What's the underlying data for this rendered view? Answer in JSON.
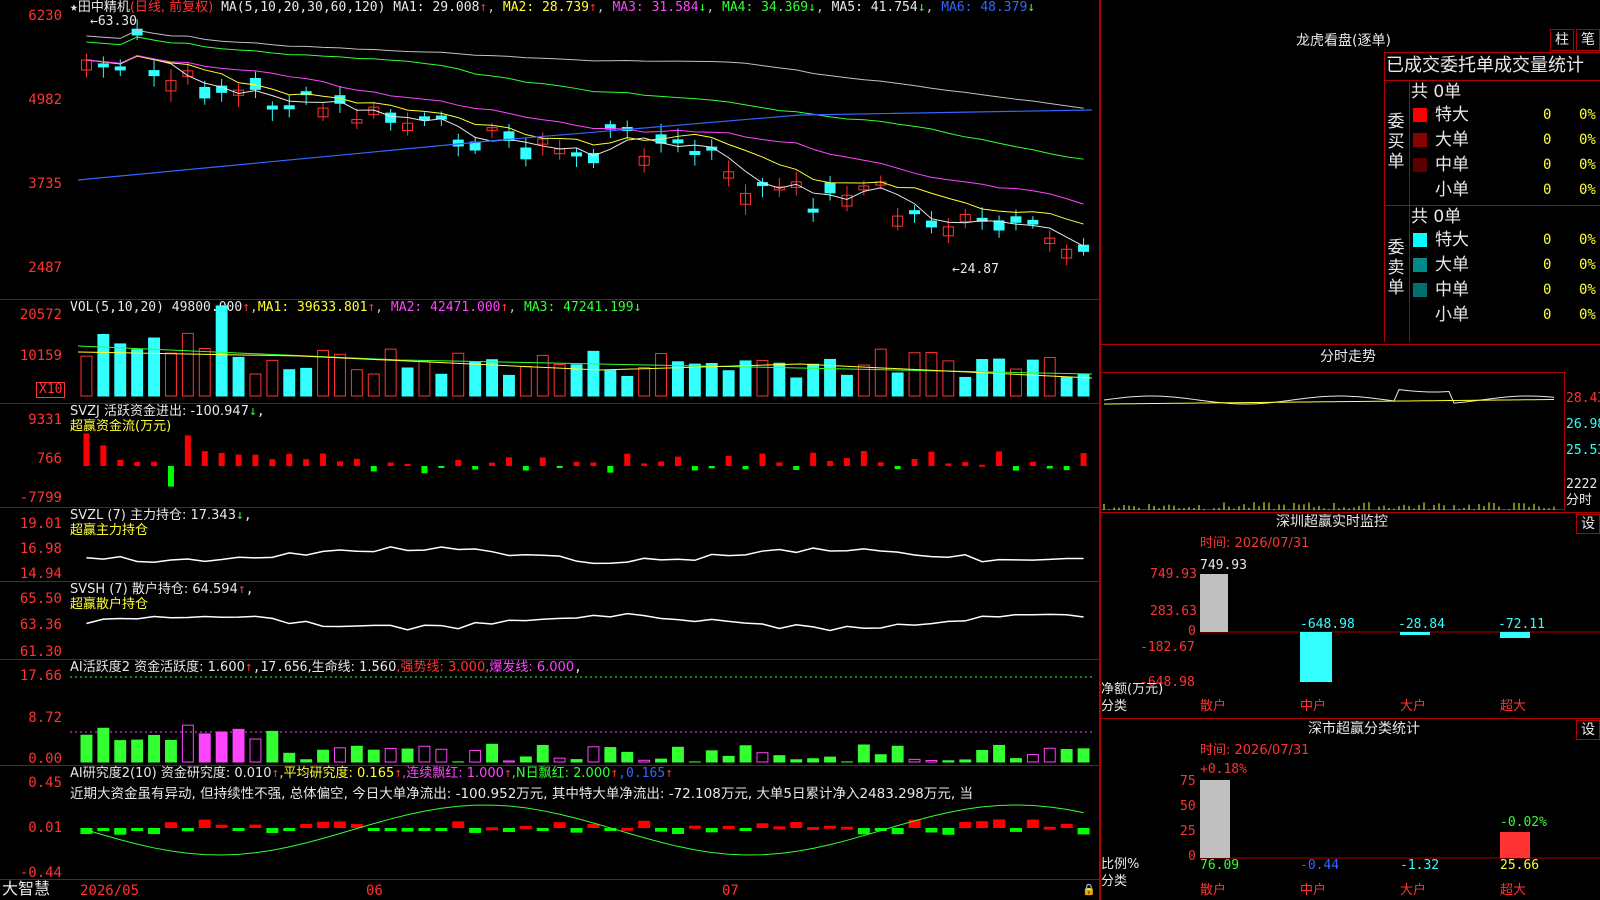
{
  "app": {
    "brand": "大智慧",
    "title_mark": "★",
    "stock_name": "田中精机",
    "period": "(日线, 前复权)"
  },
  "colors": {
    "up": "#ff3333",
    "down": "#33ffff",
    "ma1": "#e8e8e8",
    "ma2": "#ffff33",
    "ma3": "#ff44ff",
    "ma4": "#33ff33",
    "ma5": "#c0c0c0",
    "ma6": "#3366ff",
    "grid": "#b00000"
  },
  "price_pane": {
    "ma_header": "MA(5,10,20,30,60,120)",
    "ma1": "MA1: 29.008",
    "ma2": "MA2: 28.739",
    "ma3": "MA3: 31.584",
    "ma4": "MA4: 34.369",
    "ma5": "MA5: 41.754",
    "ma6": "MA6: 48.379",
    "ma1_arrow": "↑",
    "ma2_arrow": "↑",
    "ma3_arrow": "↓",
    "ma4_arrow": "↓",
    "ma5_arrow": "↓",
    "ma6_arrow": "↓",
    "y_ticks": [
      "6230",
      "4982",
      "3735",
      "2487"
    ],
    "high_mark": "←63.30",
    "low_mark": "←24.87"
  },
  "vol_pane": {
    "header": "VOL(5,10,20)",
    "value": "49800.000",
    "value_arrow": "↑",
    "ma1": "MA1: 39633.801",
    "ma1_arrow": "↑",
    "ma2": "MA2: 42471.000",
    "ma2_arrow": "↑",
    "ma3": "MA3: 47241.199",
    "ma3_arrow": "↓",
    "y_ticks": [
      "20572",
      "10159"
    ],
    "unit": "X10"
  },
  "svzj_pane": {
    "header": "SVZJ  活跃资金进出: -100.947",
    "arrow": "↓",
    "tail": ",",
    "sub": "超赢资金流(万元)",
    "y_ticks": [
      "9331",
      "766",
      "-7799"
    ]
  },
  "svzl_pane": {
    "header": "SVZL (7) 主力持仓: 17.343",
    "arrow": "↓",
    "tail": ",",
    "sub": "超赢主力持仓",
    "y_ticks": [
      "19.01",
      "16.98",
      "14.94"
    ]
  },
  "svsh_pane": {
    "header": "SVSH (7) 散户持仓: 64.594",
    "arrow": "↑",
    "tail": ",",
    "sub": "超赢散户持仓",
    "y_ticks": [
      "65.50",
      "63.36",
      "61.30"
    ]
  },
  "ai_act_pane": {
    "h1": "AI活跃度2 资金活跃度: 1.600",
    "h1_arrow": "↑",
    "h2": ",17.656",
    "h3": ",生命线: 1.560",
    "h4": ",强势线: 3.000",
    "h5": ",爆发线: 6.000",
    "h6": ",",
    "y_ticks": [
      "17.66",
      "8.72",
      "0.00"
    ]
  },
  "ai_res_pane": {
    "h1": "AI研究度2(10) 资金研究度: 0.010",
    "h1_arrow": "↑",
    "h2": ",平均研究度: 0.165",
    "h2_arrow": "↑",
    "h3": ",连续飘红: 1.000",
    "h3_arrow": "↑",
    "h4": ",N日飘红: 2.000",
    "h4_arrow": "↑",
    "h5": ",0.165",
    "h5_arrow": "↑",
    "note": "近期大资金虽有异动, 但持续性不强, 总体偏空, 今日大单净流出: -100.952万元, 其中特大单净流出: -72.108万元, 大单5日累计净入2483.298万元, 当",
    "y_ticks": [
      "0.45",
      "0.01",
      "-0.44"
    ]
  },
  "x_axis": {
    "labels": [
      "2026/05",
      "06",
      "07"
    ]
  },
  "dragon": {
    "title": "龙虎看盘(逐单)",
    "btn1": "柱",
    "btn2": "笔",
    "tabs": "已成交委托单成交量统计",
    "buy_label": "委买单",
    "buy_total": "共 0单",
    "sell_label": "委卖单",
    "sell_total": "共 0单",
    "rows_buy": [
      {
        "name": "特大",
        "v": "0",
        "p": "0%",
        "color": "#ff0000"
      },
      {
        "name": "大单",
        "v": "0",
        "p": "0%",
        "color": "#8b0000"
      },
      {
        "name": "中单",
        "v": "0",
        "p": "0%",
        "color": "#5a0000"
      },
      {
        "name": "小单",
        "v": "0",
        "p": "0%",
        "color": "#000000"
      }
    ],
    "rows_sell": [
      {
        "name": "特大",
        "v": "0",
        "p": "0%",
        "color": "#00ffff"
      },
      {
        "name": "大单",
        "v": "0",
        "p": "0%",
        "color": "#008b8b"
      },
      {
        "name": "中单",
        "v": "0",
        "p": "0%",
        "color": "#006f6f"
      },
      {
        "name": "小单",
        "v": "0",
        "p": "0%",
        "color": "#000000"
      }
    ]
  },
  "intraday": {
    "title": "分时走势",
    "y_ticks": [
      "28.43",
      "26.98",
      "25.53"
    ],
    "vol": "2222",
    "unit": "分时"
  },
  "sz_monitor": {
    "title": "深圳超赢实时监控",
    "btn": "设",
    "time": "时间: 2026/07/31",
    "y_ticks": [
      "749.93",
      "283.63",
      "0",
      "-182.67",
      "-648.98"
    ],
    "ylabel1": "净额(万元)",
    "ylabel2": "分类",
    "cats": [
      "散户",
      "中户",
      "大户",
      "超大"
    ],
    "values": [
      "749.93",
      "-648.98",
      "-28.84",
      "-72.11"
    ]
  },
  "sz_class": {
    "title": "深市超赢分类统计",
    "btn": "设",
    "time": "时间: 2026/07/31",
    "y_ticks": [
      "75",
      "50",
      "25",
      "0"
    ],
    "ylabel1": "比例%",
    "ylabel2": "分类",
    "cats": [
      "散户",
      "中户",
      "大户",
      "超大"
    ],
    "pct": [
      "76.09",
      "-0.44",
      "-1.32",
      "25.66"
    ],
    "top": [
      "+0.18%",
      "",
      "",
      "-0.02%"
    ]
  }
}
